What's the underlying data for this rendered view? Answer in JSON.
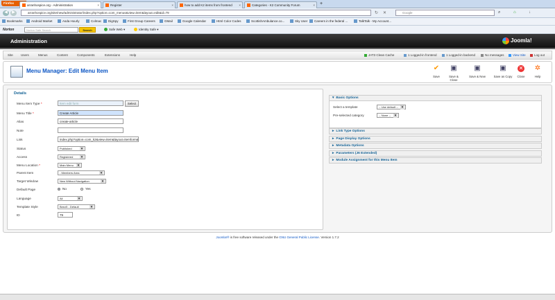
{
  "browser": {
    "firefox_label": "Firefox",
    "tabs": [
      {
        "label": "arranhospice.org - Administration",
        "active": true
      },
      {
        "label": "Register",
        "active": false
      },
      {
        "label": "how to add K2 items from frontend",
        "active": false
      },
      {
        "label": "Categories - K2 Community Forum",
        "active": false
      }
    ],
    "url": "arranhospice.org/site/new/administrator/index.php?option=com_menus&view=item&layout=edit&id=79",
    "search_placeholder": "Google",
    "bookmarks": [
      "Bookmarks",
      "Android Market",
      "Asda Hourly",
      "Colmac",
      "DigSpy",
      "First Group Careers",
      "GMail",
      "Google Calendar",
      "Html Color Codes",
      "ScottishAmbulance.co...",
      "Sky User",
      "Careers in the federal ...",
      "TalkTalk - My Account..."
    ],
    "norton": {
      "logo": "Norton",
      "search_placeholder": "Norton Safe Search",
      "search_button": "Search",
      "safe_web": "Safe Web",
      "identity_safe": "Identity Safe"
    }
  },
  "header": {
    "title": "Administration",
    "logo": "Joomla!"
  },
  "menu": {
    "items": [
      "Site",
      "Users",
      "Menus",
      "Content",
      "Components",
      "Extensions",
      "Help"
    ],
    "status": [
      "JAT3 Clean Cache",
      "1 Logged-in frontend",
      "1 Logged-in backend",
      "No messages",
      "View Site",
      "Log out"
    ]
  },
  "toolbar": {
    "title": "Menu Manager: Edit Menu Item",
    "buttons": [
      "Save",
      "Save & Close",
      "Save & New",
      "Save as Copy",
      "Close",
      "Help"
    ]
  },
  "details": {
    "legend": "Details",
    "labels": {
      "menu_item_type": "Menu Item Type",
      "menu_title": "Menu Title",
      "alias": "Alias",
      "note": "Note",
      "link": "Link",
      "status": "Status",
      "access": "Access",
      "menu_location": "Menu Location",
      "parent_item": "Parent Item",
      "target_window": "Target Window",
      "default_page": "Default Page",
      "language": "Language",
      "template_style": "Template Style",
      "id": "ID"
    },
    "required_mark": "*",
    "values": {
      "menu_item_type": "Item edit form",
      "menu_title": "Create Article",
      "alias": "create-article",
      "note": "",
      "link": "index.php?option=com_k2&view=item&layout=itemform&task=add",
      "status": "Published",
      "access": "Registered",
      "menu_location": "Main Menu",
      "parent_item": "- Members Area",
      "target_window": "New Without Navigation",
      "default_page_no": "No",
      "default_page_yes": "Yes",
      "language": "All",
      "template_style": "Beez5 - Default",
      "id": "79"
    },
    "select_button": "Select"
  },
  "right": {
    "basic_options": "Basic Options",
    "select_template_label": "Select a template",
    "select_template_value": "-- Use default --",
    "preselected_label": "Pre-selected category",
    "preselected_value": "-- None --",
    "panels": [
      "Link Type Options",
      "Page Display Options",
      "Metadata Options",
      "Parameters (J6 Extended)",
      "Module Assignment for this Menu Item"
    ]
  },
  "footer": {
    "link": "Joomla!®",
    "text": " is free software released under the ",
    "license": "GNU General Public License",
    "version": ". Version 1.7.2"
  }
}
